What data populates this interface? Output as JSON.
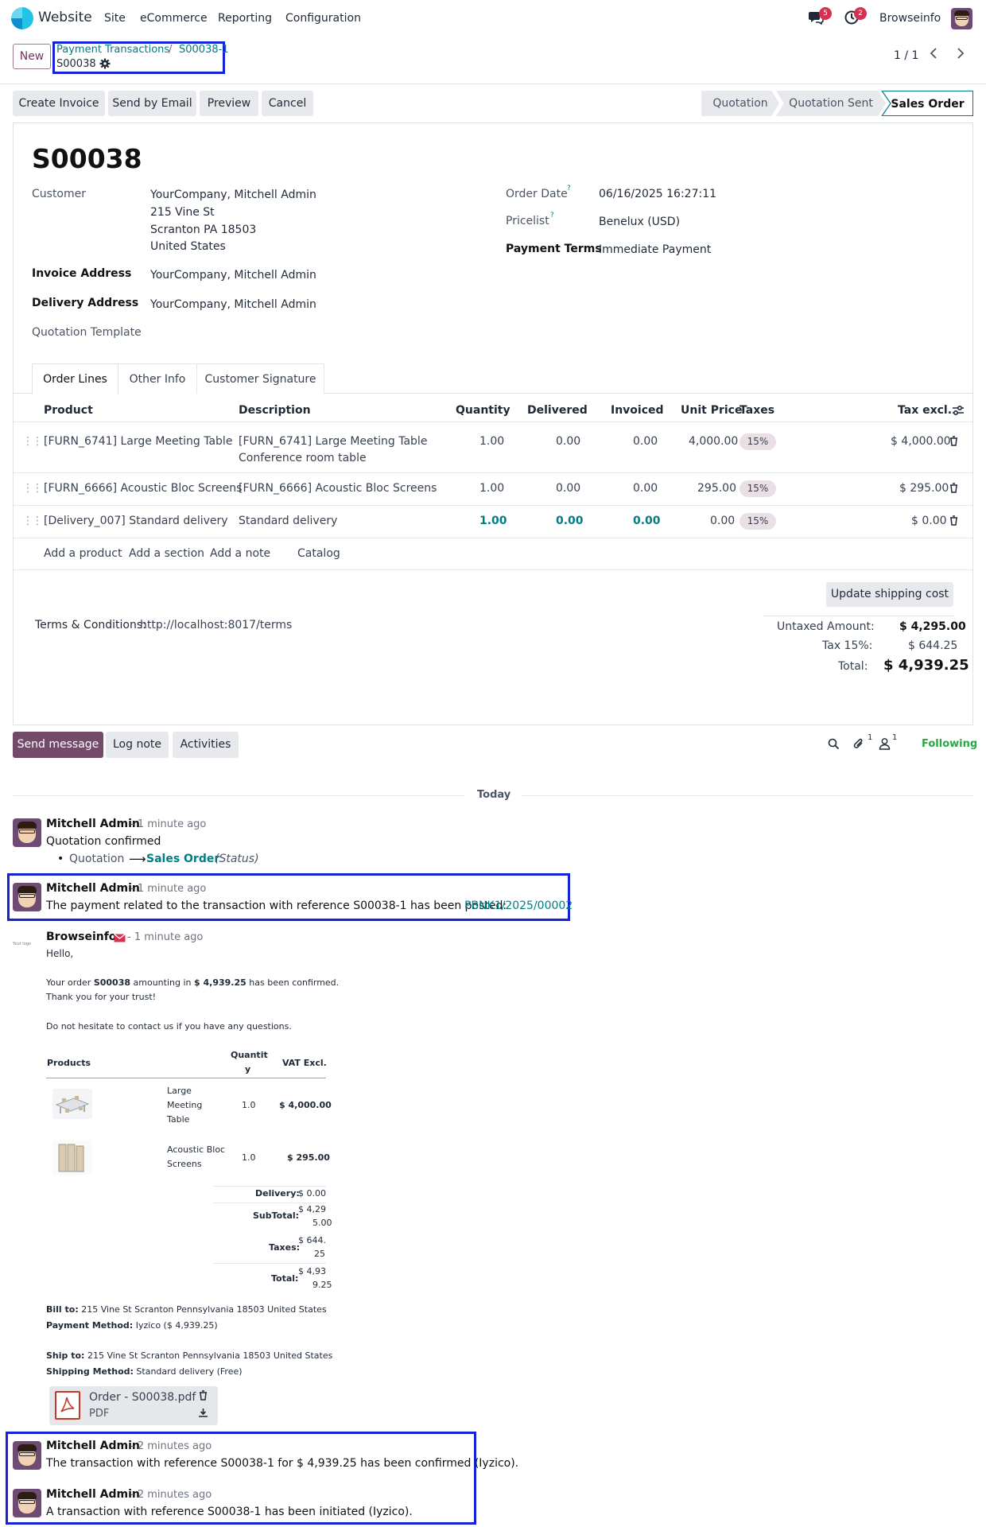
{
  "navbar": {
    "app_name": "Website",
    "menu": [
      "Site",
      "eCommerce",
      "Reporting",
      "Configuration"
    ],
    "messages_count": "5",
    "activities_count": "2",
    "company": "Browseinfo"
  },
  "control": {
    "new_label": "New",
    "breadcrumb_parent": "Payment Transactions",
    "breadcrumb_sep": "/",
    "breadcrumb_child": "S00038-1",
    "record_name": "S00038",
    "pager": "1 / 1"
  },
  "actions": {
    "create_invoice": "Create Invoice",
    "send_email": "Send by Email",
    "preview": "Preview",
    "cancel": "Cancel"
  },
  "statusbar": [
    "Quotation",
    "Quotation Sent",
    "Sales Order"
  ],
  "order": {
    "name": "S00038",
    "customer_label": "Customer",
    "customer_name": "YourCompany, Mitchell Admin",
    "address_1": "215 Vine St",
    "address_2": "Scranton PA 18503",
    "address_3": "United States",
    "invoice_label": "Invoice Address",
    "invoice_value": "YourCompany, Mitchell Admin",
    "delivery_label": "Delivery Address",
    "delivery_value": "YourCompany, Mitchell Admin",
    "template_label": "Quotation Template",
    "order_date_label": "Order Date",
    "order_date": "06/16/2025 16:27:11",
    "pricelist_label": "Pricelist",
    "pricelist": "Benelux (USD)",
    "terms_label": "Payment Terms",
    "terms": "Immediate Payment",
    "help_mark": "?"
  },
  "tabs": [
    "Order Lines",
    "Other Info",
    "Customer Signature"
  ],
  "lines": {
    "headers": [
      "Product",
      "Description",
      "Quantity",
      "Delivered",
      "Invoiced",
      "Unit Price",
      "Taxes",
      "Tax excl."
    ],
    "rows": [
      {
        "product": "[FURN_6741] Large Meeting Table",
        "desc1": "[FURN_6741] Large Meeting Table",
        "desc2": "Conference room table",
        "qty": "1.00",
        "delivered": "0.00",
        "invoiced": "0.00",
        "price": "4,000.00",
        "tax": "15%",
        "subtotal": "$ 4,000.00"
      },
      {
        "product": "[FURN_6666] Acoustic Bloc Screens",
        "desc1": "[FURN_6666] Acoustic Bloc Screens",
        "desc2": "",
        "qty": "1.00",
        "delivered": "0.00",
        "invoiced": "0.00",
        "price": "295.00",
        "tax": "15%",
        "subtotal": "$ 295.00"
      },
      {
        "product": "[Delivery_007] Standard delivery",
        "desc1": "Standard delivery",
        "desc2": "",
        "qty": "1.00",
        "delivered": "0.00",
        "invoiced": "0.00",
        "price": "0.00",
        "tax": "15%",
        "subtotal": "$ 0.00"
      }
    ],
    "add_product": "Add a product",
    "add_section": "Add a section",
    "add_note": "Add a note",
    "catalog": "Catalog"
  },
  "totals": {
    "update_shipping": "Update shipping cost",
    "terms_label": "Terms & Conditions:",
    "terms_link": "http://localhost:8017/terms",
    "untaxed_label": "Untaxed Amount:",
    "untaxed": "$ 4,295.00",
    "tax_label": "Tax 15%:",
    "tax": "$ 644.25",
    "total_label": "Total:",
    "total": "$ 4,939.25"
  },
  "chatter": {
    "send_message": "Send message",
    "log_note": "Log note",
    "activities": "Activities",
    "attach_count": "1",
    "follower_count": "1",
    "following": "Following",
    "today": "Today",
    "m1_author": "Mitchell Admin",
    "m1_ago": "- 1 minute ago",
    "m1_text": "Quotation confirmed",
    "m1_from": "Quotation",
    "m1_to": "Sales Order",
    "m1_field": "(Status)",
    "m2_author": "Mitchell Admin",
    "m2_ago": "- 1 minute ago",
    "m2_text": "The payment related to the transaction with reference S00038-1 has been posted:",
    "m2_link": "PBNK1/2025/00002",
    "m3_author": "Browseinfo",
    "m3_ago": "- 1 minute ago",
    "m3_logo": "Your logo",
    "m5_author": "Mitchell Admin",
    "m5_ago": "- 2 minutes ago",
    "m5_text": "The transaction with reference S00038-1 for $ 4,939.25 has been confirmed (Iyzico).",
    "m6_author": "Mitchell Admin",
    "m6_ago": "- 2 minutes ago",
    "m6_text": "A transaction with reference S00038-1 has been initiated (Iyzico)."
  },
  "email": {
    "hello": "Hello,",
    "line1_a": "Your order",
    "line1_b": "S00038",
    "line1_c": "amounting in",
    "line1_d": "$ 4,939.25",
    "line1_e": "has been confirmed.",
    "line2": "Thank you for your trust!",
    "line3": "Do not hesitate to contact us if you have any questions.",
    "col_products": "Products",
    "col_qty_1": "Quantit",
    "col_qty_2": "y",
    "col_vat": "VAT Excl.",
    "p1_l1": "Large",
    "p1_l2": "Meeting",
    "p1_l3": "Table",
    "p1_qty": "1.0",
    "p1_amt": "$ 4,000.00",
    "p2_l1": "Acoustic Bloc",
    "p2_l2": "Screens",
    "p2_qty": "1.0",
    "p2_amt": "$ 295.00",
    "delivery_label": "Delivery:",
    "delivery": "$ 0.00",
    "subtotal_label": "SubTotal:",
    "subtotal_1": "$ 4,29",
    "subtotal_2": "5.00",
    "taxes_label": "Taxes:",
    "taxes_1": "$ 644.",
    "taxes_2": "25",
    "total_label": "Total:",
    "total_1": "$ 4,93",
    "total_2": "9.25",
    "bill_label": "Bill to:",
    "bill": "215 Vine St Scranton Pennsylvania 18503 United States",
    "paym_label": "Payment Method:",
    "paym": "Iyzico ($ 4,939.25)",
    "ship_label": "Ship to:",
    "ship": "215 Vine St Scranton Pennsylvania 18503 United States",
    "shipm_label": "Shipping Method:",
    "shipm": "Standard delivery (Free)",
    "attachment_name": "Order - S00038.pdf",
    "attachment_type": "PDF"
  }
}
